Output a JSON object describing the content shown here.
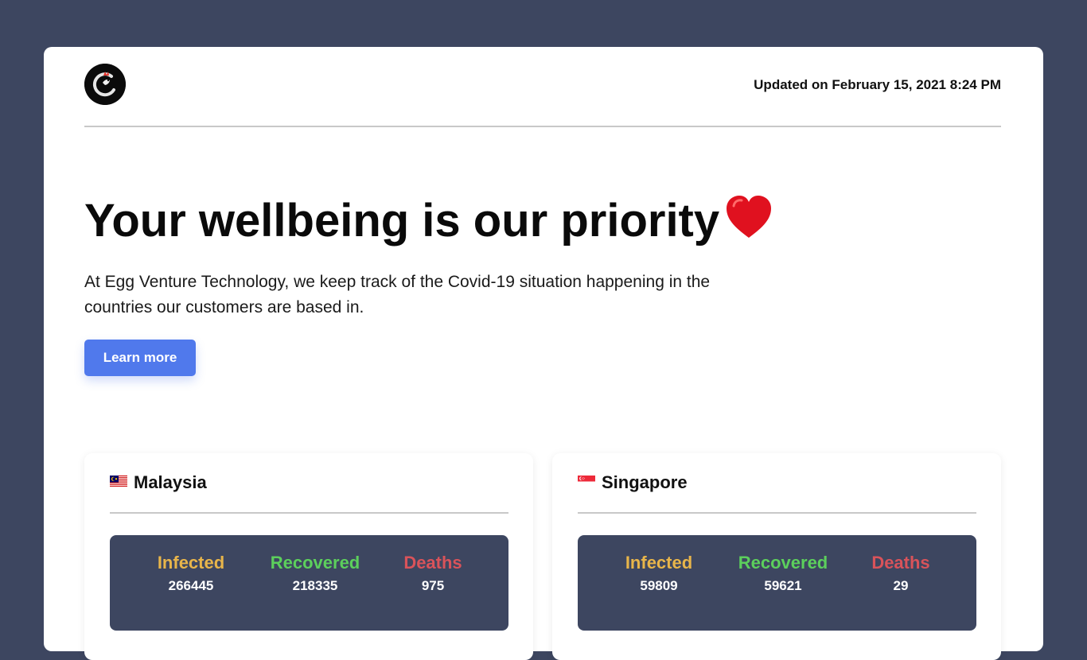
{
  "header": {
    "logo_icon": "rooster-c-logo-icon",
    "updated_text": "Updated on February 15, 2021 8:24 PM"
  },
  "hero": {
    "title": "Your wellbeing is our priority",
    "title_icon": "red-heart-icon",
    "description": "At Egg Venture Technology, we keep track of the Covid-19 situation happening in the countries our customers are based in.",
    "button_label": "Learn more"
  },
  "colors": {
    "background": "#3d4660",
    "accent": "#5079ec",
    "infected": "#e8b54a",
    "recovered": "#5ccf5c",
    "deaths": "#d9535a"
  },
  "countries": [
    {
      "flag_icon": "malaysia-flag-icon",
      "name": "Malaysia",
      "infected_label": "Infected",
      "infected_value": "266445",
      "recovered_label": "Recovered",
      "recovered_value": "218335",
      "deaths_label": "Deaths",
      "deaths_value": "975"
    },
    {
      "flag_icon": "singapore-flag-icon",
      "name": "Singapore",
      "infected_label": "Infected",
      "infected_value": "59809",
      "recovered_label": "Recovered",
      "recovered_value": "59621",
      "deaths_label": "Deaths",
      "deaths_value": "29"
    }
  ]
}
